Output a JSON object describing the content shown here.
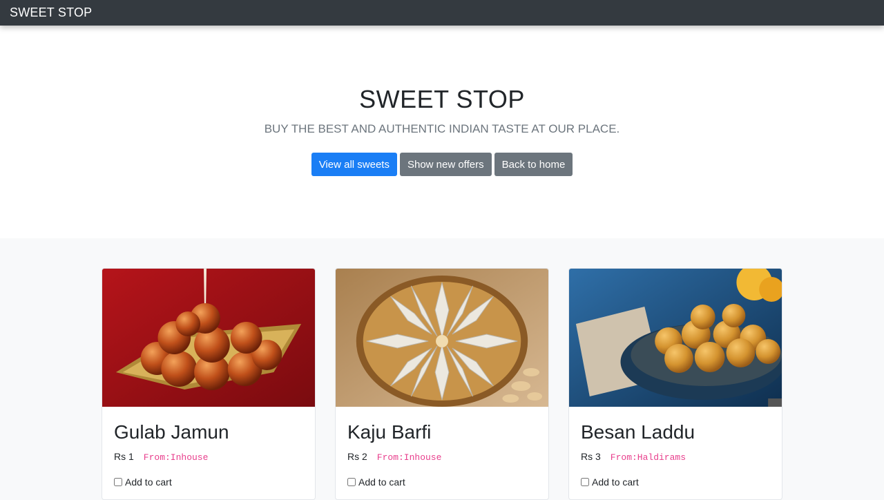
{
  "navbar": {
    "brand": "SWEET STOP"
  },
  "hero": {
    "title": "SWEET STOP",
    "lead": "BUY THE BEST AND AUTHENTIC INDIAN TASTE AT OUR PLACE.",
    "buttons": {
      "view_all": "View all sweets",
      "new_offers": "Show new offers",
      "back_home": "Back to home"
    }
  },
  "products": [
    {
      "name": "Gulab Jamun",
      "price": "Rs 1",
      "source": "From:Inhouse",
      "cart_label": "Add to cart"
    },
    {
      "name": "Kaju Barfi",
      "price": "Rs 2",
      "source": "From:Inhouse",
      "cart_label": "Add to cart"
    },
    {
      "name": "Besan Laddu",
      "price": "Rs 3",
      "source": "From:Haldirams",
      "cart_label": "Add to cart"
    }
  ],
  "colors": {
    "navbar_bg": "#343a40",
    "primary": "#1a7ef5",
    "secondary": "#6c757d",
    "source_tag": "#e83e8c"
  }
}
